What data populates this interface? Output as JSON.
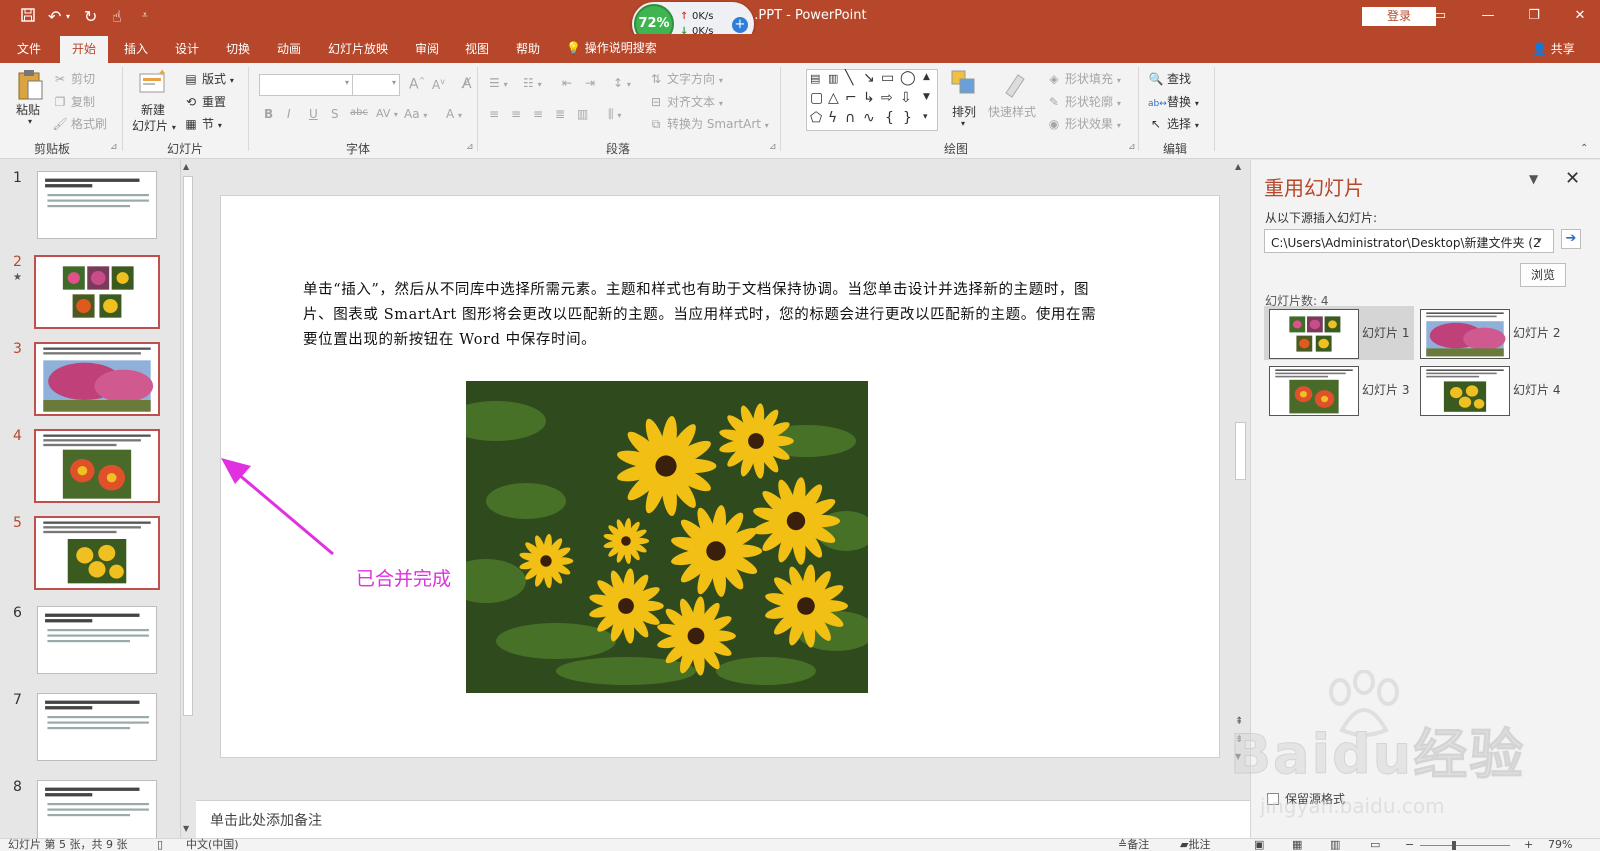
{
  "window": {
    "title": "...PPT - PowerPoint",
    "login_label": "登录",
    "controls": [
      "restore-ribbon",
      "minimize",
      "maximize",
      "close"
    ]
  },
  "quick_access": [
    "save-icon",
    "undo-icon",
    "redo-icon",
    "touch-mode-icon",
    "customize-icon"
  ],
  "net_widget": {
    "percent": "72%",
    "up_speed": "0K/s",
    "down_speed": "0K/s"
  },
  "tabs": [
    {
      "label": "文件"
    },
    {
      "label": "开始"
    },
    {
      "label": "插入"
    },
    {
      "label": "设计"
    },
    {
      "label": "切换"
    },
    {
      "label": "动画"
    },
    {
      "label": "幻灯片放映"
    },
    {
      "label": "审阅"
    },
    {
      "label": "视图"
    },
    {
      "label": "帮助"
    }
  ],
  "active_tab": "开始",
  "tell_me": "操作说明搜索",
  "share_label": "共享",
  "ribbon": {
    "clipboard": {
      "paste": "粘贴",
      "cut": "剪切",
      "copy": "复制",
      "format_painter": "格式刷",
      "group": "剪贴板"
    },
    "slides": {
      "new_slide_1": "新建",
      "new_slide_2": "幻灯片",
      "layout": "版式",
      "reset": "重置",
      "section": "节",
      "group": "幻灯片"
    },
    "font": {
      "group": "字体",
      "bold": "B",
      "italic": "I",
      "underline": "U",
      "shadow": "S",
      "strike": "abc",
      "spacing": "AV",
      "case": "Aa",
      "color": "A",
      "grow": "A",
      "shrink": "A"
    },
    "paragraph": {
      "text_direction": "文字方向",
      "align_text": "对齐文本",
      "smartart": "转换为 SmartArt",
      "group": "段落"
    },
    "drawing": {
      "arrange": "排列",
      "quick_styles": "快速样式",
      "shape_fill": "形状填充",
      "shape_outline": "形状轮廓",
      "shape_effects": "形状效果",
      "group": "绘图"
    },
    "editing": {
      "find": "查找",
      "replace": "替换",
      "select": "选择",
      "group": "编辑"
    }
  },
  "thumbnails": [
    {
      "num": "1",
      "type": "text"
    },
    {
      "num": "2",
      "type": "collage",
      "selected": true,
      "star": "★"
    },
    {
      "num": "3",
      "type": "pink-tree",
      "selected": true
    },
    {
      "num": "4",
      "type": "red-flowers",
      "selected": true
    },
    {
      "num": "5",
      "type": "yellow-flowers",
      "selected": true
    },
    {
      "num": "6",
      "type": "text"
    },
    {
      "num": "7",
      "type": "text"
    },
    {
      "num": "8",
      "type": "text"
    }
  ],
  "slide": {
    "text": "单击“插入”，然后从不同库中选择所需元素。主题和样式也有助于文档保持协调。当您单击设计并选择新的主题时，图片、图表或 SmartArt 图形将会更改以匹配新的主题。当应用样式时，您的标题会进行更改以匹配新的主题。使用在需要位置出现的新按钮在 Word 中保存时间。",
    "annotation": "已合并完成"
  },
  "notes_placeholder": "单击此处添加备注",
  "reuse_pane": {
    "title": "重用幻灯片",
    "source_label": "从以下源插入幻灯片:",
    "source_path": "C:\\Users\\Administrator\\Desktop\\新建文件夹 (2",
    "browse": "浏览",
    "count_label": "幻灯片数: 4",
    "items": [
      {
        "label": "幻灯片 1",
        "type": "collage"
      },
      {
        "label": "幻灯片 2",
        "type": "pink-tree"
      },
      {
        "label": "幻灯片 3",
        "type": "red-flowers"
      },
      {
        "label": "幻灯片 4",
        "type": "yellow-flowers"
      }
    ],
    "keep_format": "保留源格式"
  },
  "statusbar": {
    "slide_info": "幻灯片 第 5 张，共 9 张",
    "language": "中文(中国)",
    "notes": "备注",
    "comments": "批注",
    "zoom": "79%"
  },
  "watermark": {
    "logo": "Baidu经验",
    "url": "jingyan.baidu.com"
  },
  "colors": {
    "accent": "#b7472a",
    "selection": "#c0504d",
    "annotation": "#e030e0"
  }
}
